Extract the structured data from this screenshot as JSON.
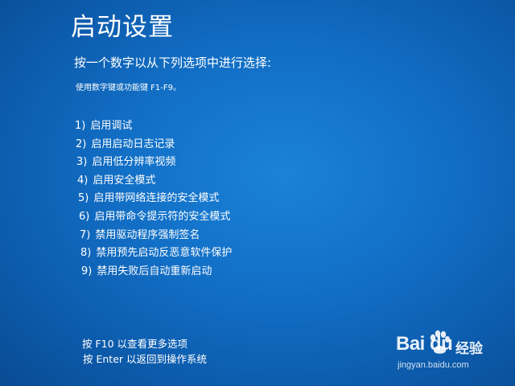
{
  "screen": {
    "title": "启动设置",
    "prompt": "按一个数字以从下列选项中进行选择:",
    "hint": "使用数字键或功能键 F1-F9。"
  },
  "options": [
    {
      "number": "1)",
      "label": "启用调试"
    },
    {
      "number": "2)",
      "label": "启用启动日志记录"
    },
    {
      "number": "3)",
      "label": "启用低分辨率视频"
    },
    {
      "number": "4)",
      "label": "启用安全模式"
    },
    {
      "number": "5)",
      "label": "启用带网络连接的安全模式"
    },
    {
      "number": "6)",
      "label": "启用带命令提示符的安全模式"
    },
    {
      "number": "7)",
      "label": "禁用驱动程序强制签名"
    },
    {
      "number": "8)",
      "label": "禁用预先启动反恶意软件保护"
    },
    {
      "number": "9)",
      "label": "禁用失败后自动重新启动"
    }
  ],
  "footer": {
    "more_options": "按 F10 以查看更多选项",
    "return": "按 Enter 以返回到操作系统"
  },
  "watermark": {
    "brand": "Bai  du",
    "service": "经验",
    "url": "jingyan.baidu.com"
  },
  "colors": {
    "background": "#126fc6",
    "text": "#ffffff"
  }
}
